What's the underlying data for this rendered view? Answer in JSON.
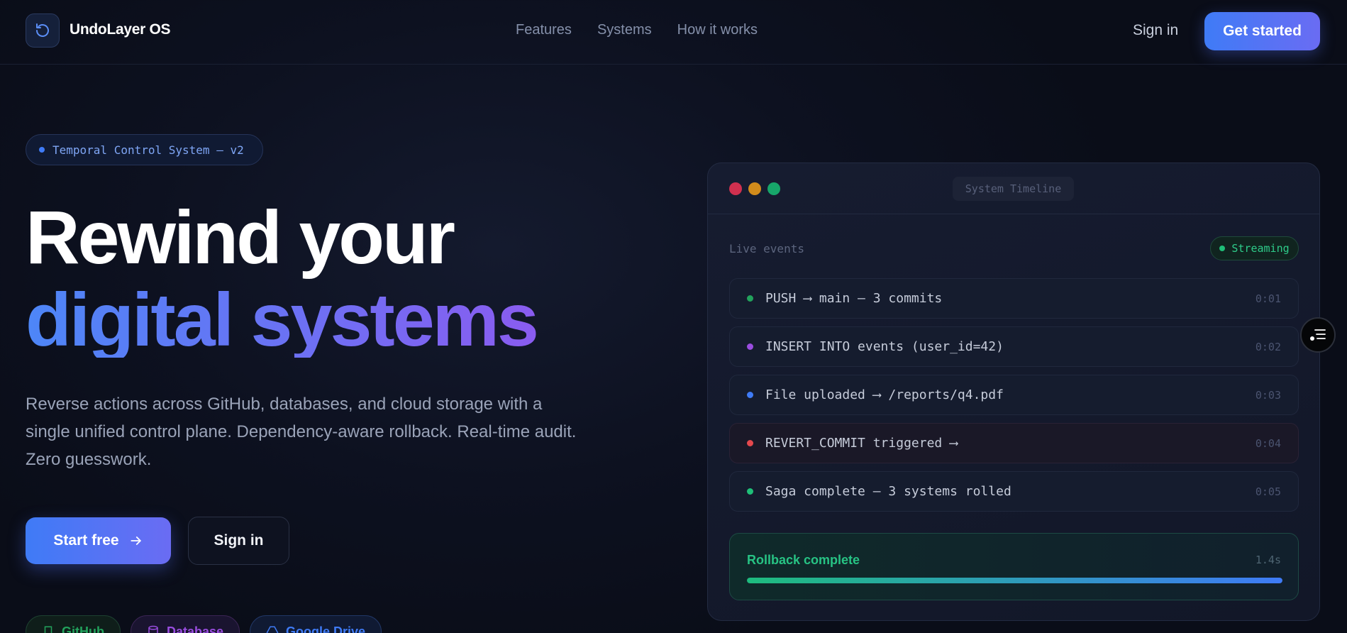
{
  "header": {
    "brand": "UndoLayer OS",
    "nav": [
      "Features",
      "Systems",
      "How it works"
    ],
    "sign_in": "Sign in",
    "cta": "Get started"
  },
  "hero": {
    "badge": "Temporal Control System — v2",
    "title_line1": "Rewind your",
    "title_line2": "digital systems",
    "subtitle": "Reverse actions across GitHub, databases, and cloud storage with a single unified control plane. Dependency-aware rollback. Real-time audit. Zero guesswork.",
    "primary_button": "Start free",
    "secondary_button": "Sign in",
    "chips": [
      "GitHub",
      "Database",
      "Google Drive"
    ]
  },
  "timeline_card": {
    "window_title": "System Timeline",
    "section_label": "Live events",
    "status_badge": "Streaming",
    "events": [
      {
        "text": "PUSH ⟶ main — 3 commits",
        "time": "0:01",
        "color": "#22a25c"
      },
      {
        "text": "INSERT INTO events (user_id=42)",
        "time": "0:02",
        "color": "#9a4de0"
      },
      {
        "text": "File uploaded ⟶ /reports/q4.pdf",
        "time": "0:03",
        "color": "#3f7bf6"
      },
      {
        "text": "REVERT_COMMIT triggered ⟶",
        "time": "0:04",
        "color": "#e5484d"
      },
      {
        "text": "Saga complete — 3 systems rolled",
        "time": "0:05",
        "color": "#1fbf78"
      }
    ],
    "rollback": {
      "title": "Rollback complete",
      "duration": "1.4s",
      "progress": 1.0
    }
  },
  "colors": {
    "accent_blue": "#3f7bf6",
    "accent_violet": "#8a5cf0",
    "success": "#27c384"
  }
}
